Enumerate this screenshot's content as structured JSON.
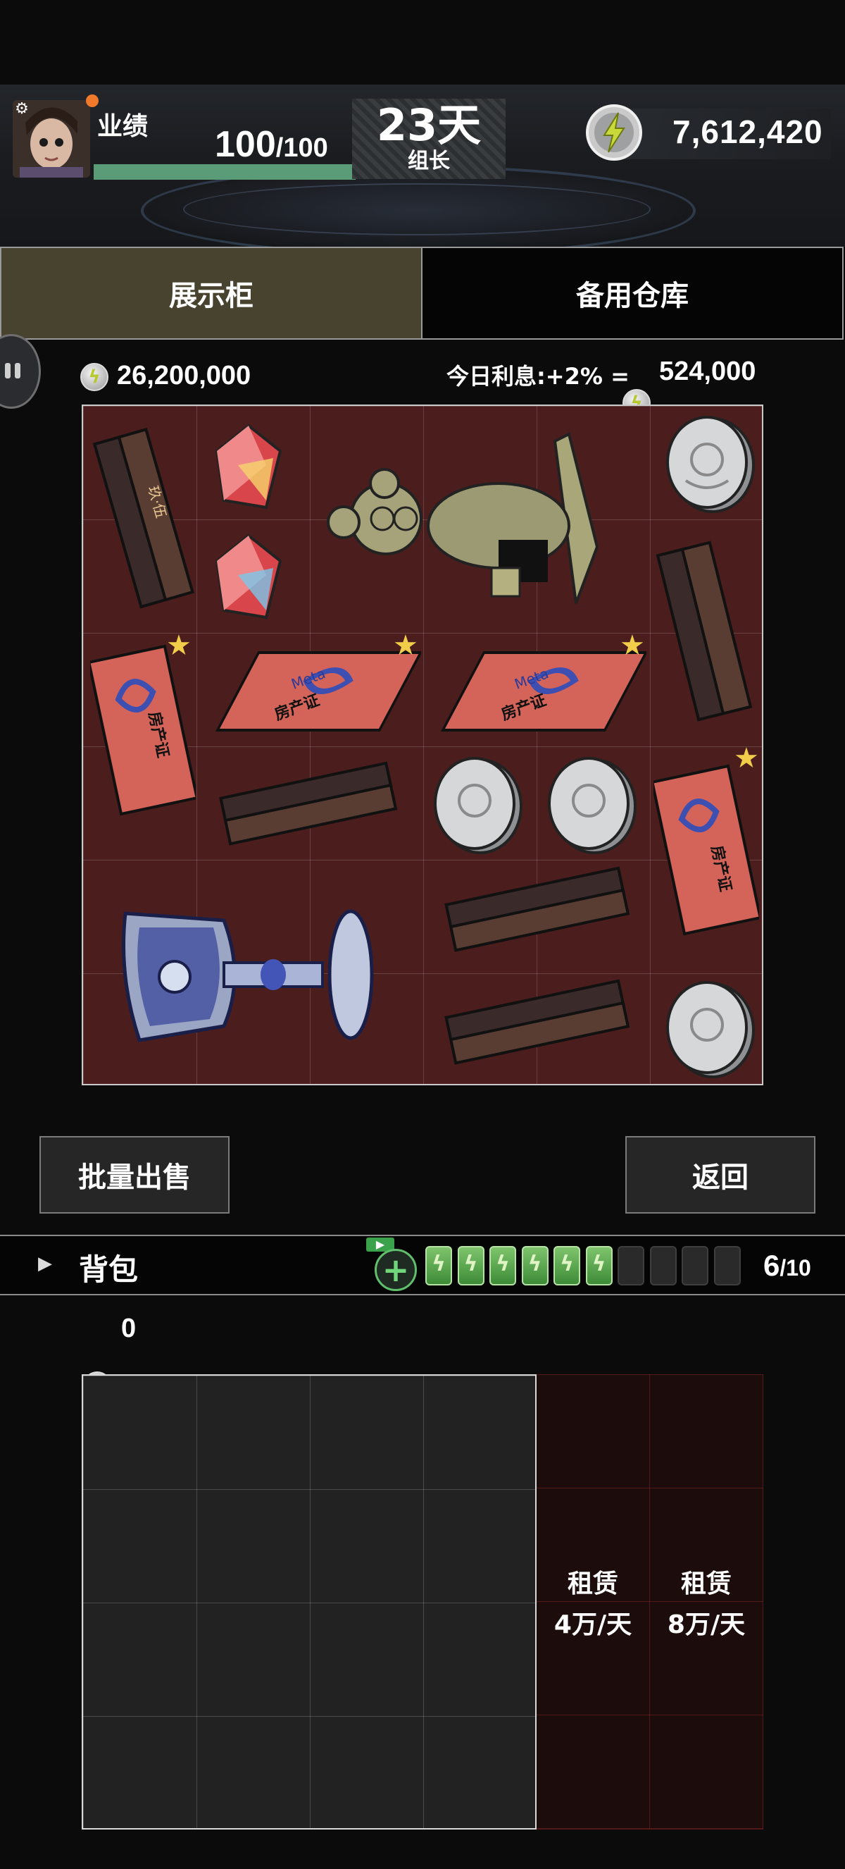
{
  "header": {
    "performance_label": "业绩",
    "performance_current": "100",
    "performance_max": "/100",
    "performance_fraction": 1.0,
    "days": "23天",
    "rank": "组长",
    "energy_total": "7,612,420"
  },
  "tabs": [
    {
      "label": "展示柜",
      "active": true
    },
    {
      "label": "备用仓库",
      "active": false
    }
  ],
  "cabinet": {
    "total_value": "26,200,000",
    "interest_label": "今日利息:+2% =",
    "interest_value": "524,000"
  },
  "items": {
    "deed_text": "房产证",
    "deed_brand": "Meta"
  },
  "buttons": {
    "bulk_sell": "批量出售",
    "back": "返回"
  },
  "backpack": {
    "label": "背包",
    "capacity": "6",
    "capacity_max": "/10",
    "batteries_full": 6,
    "batteries_total": 10,
    "value": "0"
  },
  "rent": [
    {
      "title": "租赁",
      "price": "4万/天"
    },
    {
      "title": "租赁",
      "price": "8万/天"
    }
  ],
  "colors": {
    "display_grid_bg": "#4b1d1d",
    "active_tab": "#48432f",
    "progress_fill": "#5a9c78",
    "star": "#f2cd4a",
    "battery_full": "#5fae54"
  }
}
